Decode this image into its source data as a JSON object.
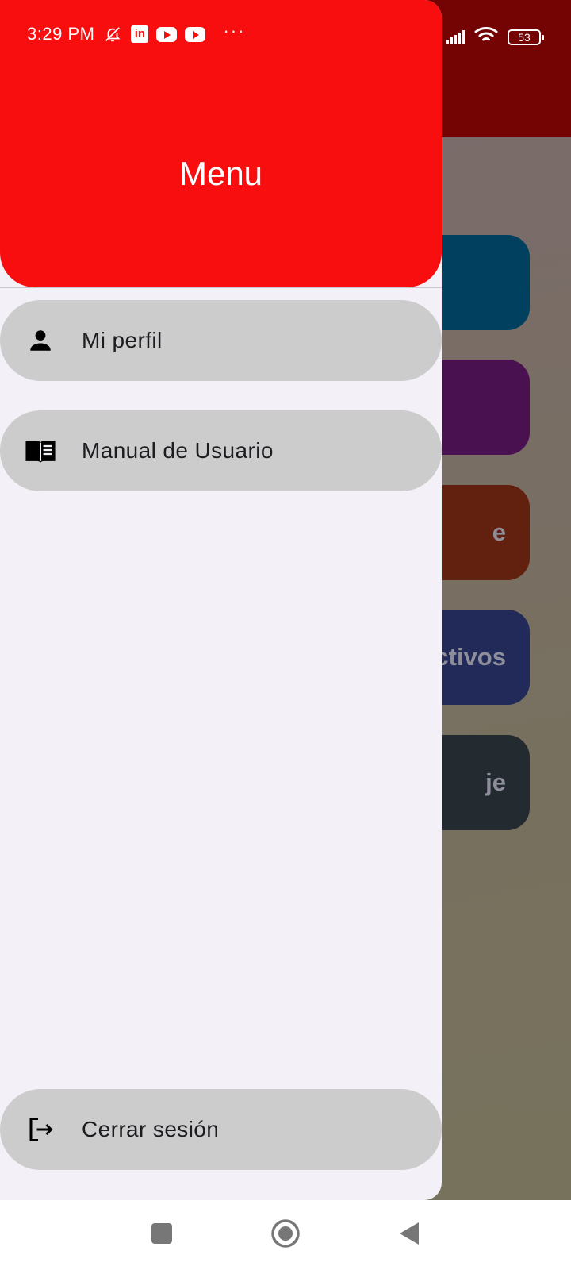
{
  "status_bar": {
    "time": "3:29 PM",
    "notification_icons": [
      "bell-off-icon",
      "linkedin-icon",
      "youtube-icon",
      "youtube-icon"
    ],
    "more": "···",
    "battery": "53"
  },
  "background_cards": [
    {
      "label": ""
    },
    {
      "label": ""
    },
    {
      "label": "e"
    },
    {
      "label": "ctivos"
    },
    {
      "label": "je"
    }
  ],
  "drawer": {
    "title": "Menu",
    "items": [
      {
        "label": "Mi perfil",
        "icon": "person-icon"
      },
      {
        "label": "Manual de Usuario",
        "icon": "book-icon"
      }
    ],
    "logout": {
      "label": "Cerrar sesión",
      "icon": "logout-icon"
    }
  },
  "nav_bar": {
    "buttons": [
      "recents-icon",
      "home-icon",
      "back-icon"
    ]
  },
  "colors": {
    "header": "#f80e0e",
    "app_bar": "#740303",
    "drawer_bg": "#f4f0f8",
    "menu_item_bg": "#cccccc"
  }
}
